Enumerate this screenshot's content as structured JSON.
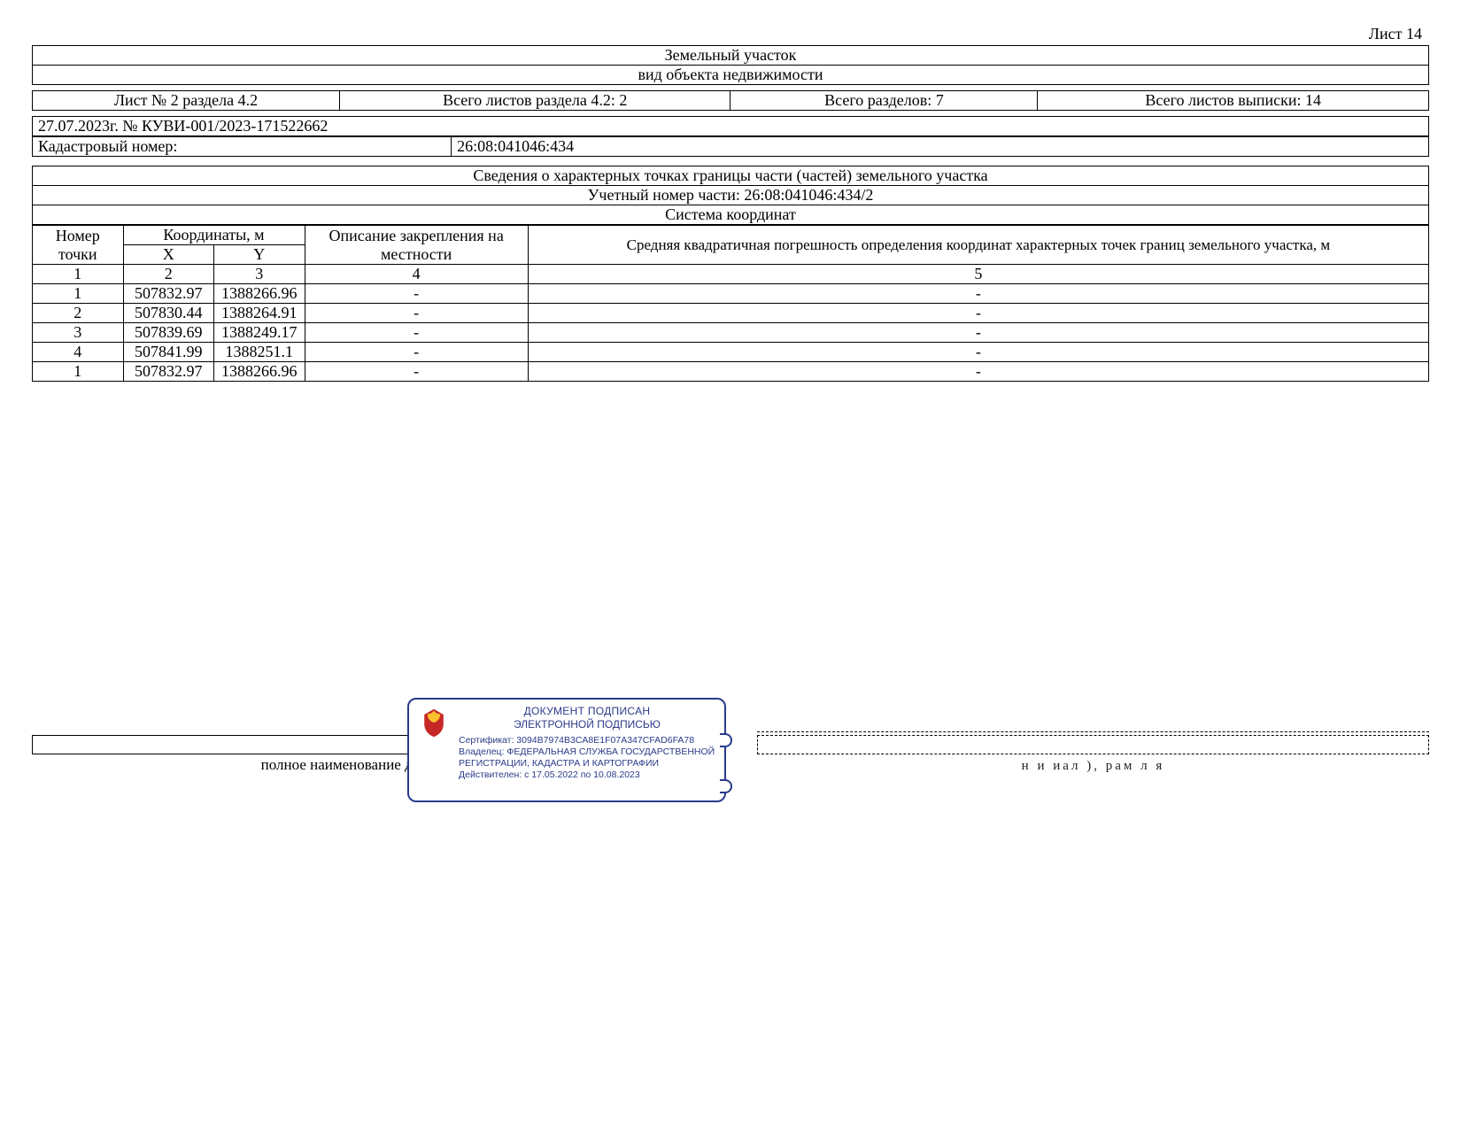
{
  "sheet_no": "Лист 14",
  "header": {
    "title": "Земельный участок",
    "subtitle": "вид объекта недвижимости"
  },
  "meta": {
    "sheet_of_section": "Лист № 2 раздела 4.2",
    "total_sheets_section": "Всего листов раздела 4.2: 2",
    "total_sections": "Всего разделов: 7",
    "total_sheets_extract": "Всего листов выписки: 14",
    "doc_no": "27.07.2023г. № КУВИ-001/2023-171522662",
    "cad_label": "Кадастровый номер:",
    "cad_no": "26:08:041046:434"
  },
  "section": {
    "title": "Сведения о характерных точках границы части (частей) земельного участка",
    "part_no": "Учетный номер части: 26:08:041046:434/2",
    "coord_system": "Система координат"
  },
  "columns": {
    "point_no": "Номер точки",
    "coords": "Координаты, м",
    "x": "X",
    "y": "Y",
    "fixation": "Описание закрепления на местности",
    "error": "Средняя квадратичная погрешность определения координат характерных точек границ земельного участка, м"
  },
  "index_row": {
    "c1": "1",
    "c2": "2",
    "c3": "3",
    "c4": "4",
    "c5": "5"
  },
  "rows": [
    {
      "n": "1",
      "x": "507832.97",
      "y": "1388266.96",
      "fix": "-",
      "err": "-"
    },
    {
      "n": "2",
      "x": "507830.44",
      "y": "1388264.91",
      "fix": "-",
      "err": "-"
    },
    {
      "n": "3",
      "x": "507839.69",
      "y": "1388249.17",
      "fix": "-",
      "err": "-"
    },
    {
      "n": "4",
      "x": "507841.99",
      "y": "1388251.1",
      "fix": "-",
      "err": "-"
    },
    {
      "n": "1",
      "x": "507832.97",
      "y": "1388266.96",
      "fix": "-",
      "err": "-"
    }
  ],
  "signature": {
    "position_label": "полное наименование должности",
    "right_label": "н   и   иал   ),   рам   л   я"
  },
  "stamp": {
    "title1": "ДОКУМЕНТ ПОДПИСАН",
    "title2": "ЭЛЕКТРОННОЙ ПОДПИСЬЮ",
    "cert": "Сертификат: 3094B7974B3CA8E1F07A347CFAD6FA78",
    "owner1": "Владелец: ФЕДЕРАЛЬНАЯ СЛУЖБА ГОСУДАРСТВЕННОЙ",
    "owner2": "РЕГИСТРАЦИИ, КАДАСТРА И КАРТОГРАФИИ",
    "valid": "Действителен: с 17.05.2022 по 10.08.2023"
  }
}
